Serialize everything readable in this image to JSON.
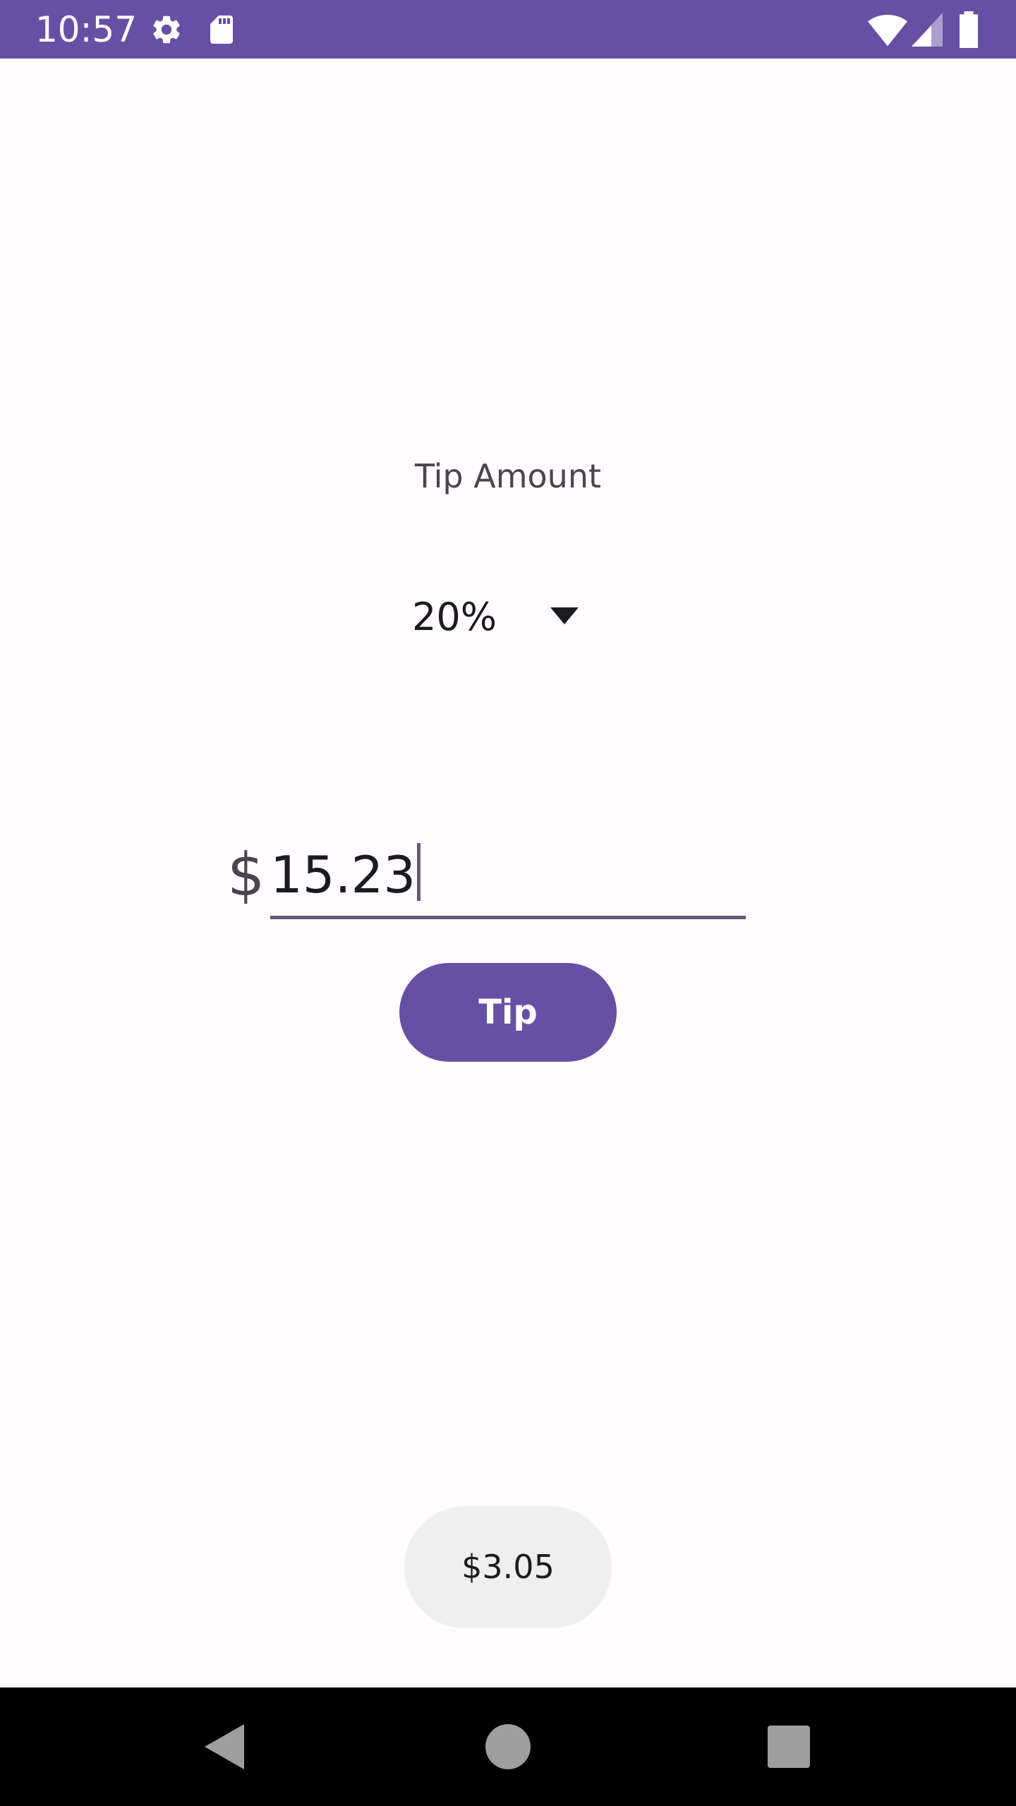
{
  "status_bar": {
    "time": "10:57",
    "icons": [
      "gear-icon",
      "sd-card-icon",
      "wifi-icon",
      "signal-icon",
      "battery-icon"
    ],
    "background": "#6750a4"
  },
  "main": {
    "label": "Tip Amount",
    "tip_percent": "20%",
    "currency_symbol": "$",
    "amount_value": "15.23",
    "tip_button_label": "Tip",
    "result_toast": "$3.05"
  },
  "nav_bar": {
    "icons": [
      "back-icon",
      "home-icon",
      "recents-icon"
    ]
  },
  "colors": {
    "primary": "#6750a4",
    "background": "#fffbfe",
    "toast_bg": "#efefef"
  }
}
